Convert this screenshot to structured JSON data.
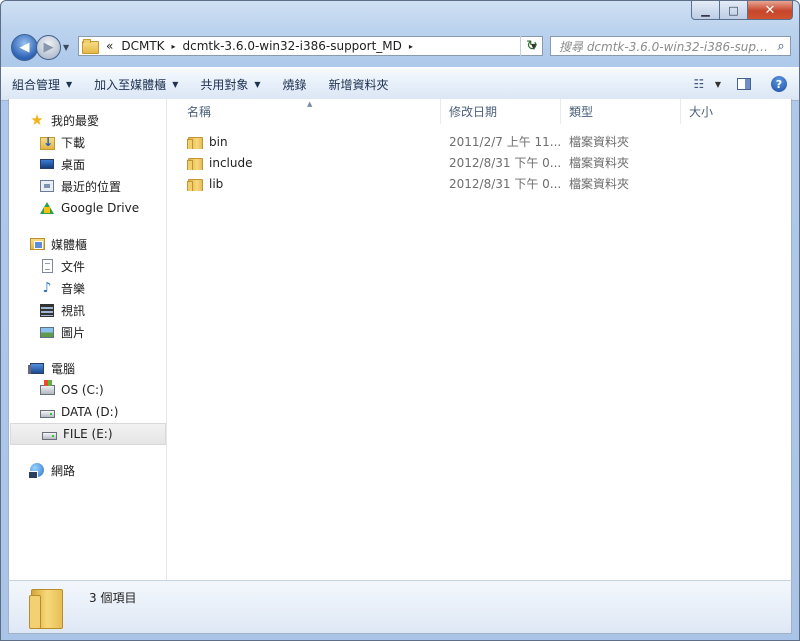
{
  "window": {
    "caption_buttons": {
      "minimize": "▁",
      "maximize": "□",
      "close": "✕"
    }
  },
  "nav": {
    "back": "◀",
    "forward": "▶",
    "recent": "▼"
  },
  "address": {
    "overflow": "«",
    "crumbs": [
      "DCMTK",
      "dcmtk-3.6.0-win32-i386-support_MD"
    ],
    "separator": "▸",
    "dropdown": "▼",
    "refresh": "↻"
  },
  "search": {
    "placeholder": "搜尋 dcmtk-3.6.0-win32-i386-supp...",
    "icon": "⌕"
  },
  "toolbar": {
    "items": [
      "組合管理",
      "加入至媒體櫃",
      "共用對象",
      "燒錄",
      "新增資料夾"
    ],
    "arrow": "▼",
    "view_icon": "☷",
    "help": "?"
  },
  "sidebar": {
    "favorites": {
      "label": "我的最愛",
      "items": [
        "下載",
        "桌面",
        "最近的位置",
        "Google Drive"
      ]
    },
    "libraries": {
      "label": "媒體櫃",
      "items": [
        "文件",
        "音樂",
        "視訊",
        "圖片"
      ]
    },
    "computer": {
      "label": "電腦",
      "items": [
        "OS (C:)",
        "DATA (D:)",
        "FILE (E:)"
      ],
      "selected": "FILE (E:)"
    },
    "network": {
      "label": "網路"
    },
    "icons": {
      "star": "★",
      "music": "♪"
    }
  },
  "columns": {
    "name": "名稱",
    "date": "修改日期",
    "type": "類型",
    "size": "大小",
    "sort": "▲"
  },
  "files": [
    {
      "name": "bin",
      "date": "2011/2/7 上午 11...",
      "type": "檔案資料夾"
    },
    {
      "name": "include",
      "date": "2012/8/31 下午 0...",
      "type": "檔案資料夾"
    },
    {
      "name": "lib",
      "date": "2012/8/31 下午 0...",
      "type": "檔案資料夾"
    }
  ],
  "status": {
    "text": "3 個項目"
  }
}
